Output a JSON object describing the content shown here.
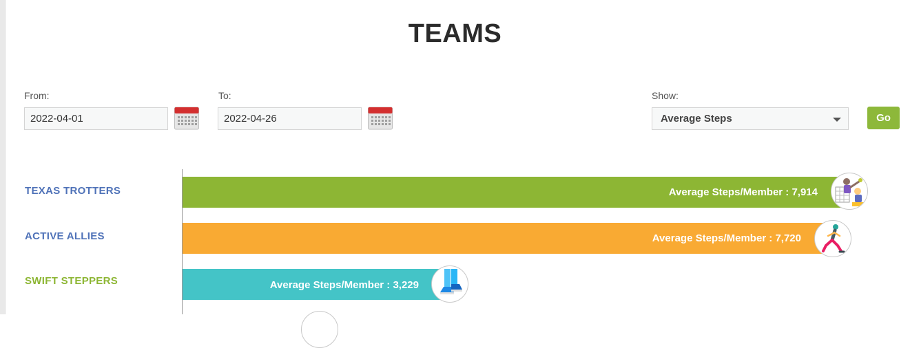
{
  "page": {
    "title": "TEAMS"
  },
  "filters": {
    "from_label": "From:",
    "from_value": "2022-04-01",
    "to_label": "To:",
    "to_value": "2022-04-26",
    "show_label": "Show:",
    "show_value": "Average Steps",
    "go_label": "Go"
  },
  "teams": [
    {
      "name": "TEXAS TROTTERS",
      "label": "Average Steps/Member : 7,914",
      "value": 7914,
      "bar_color": "#8db634",
      "name_color": "#4f72b8",
      "avatar_icon": "tennis-player-icon"
    },
    {
      "name": "ACTIVE ALLIES",
      "label": "Average Steps/Member : 7,720",
      "value": 7720,
      "bar_color": "#f9aa33",
      "name_color": "#4f72b8",
      "avatar_icon": "runner-icon"
    },
    {
      "name": "SWIFT STEPPERS",
      "label": "Average Steps/Member : 3,229",
      "value": 3229,
      "bar_color": "#44c4c7",
      "name_color": "#8db634",
      "avatar_icon": "walking-feet-icon"
    }
  ],
  "colors": {
    "go_button": "#8db83a",
    "calendar_red": "#d32f2f"
  }
}
